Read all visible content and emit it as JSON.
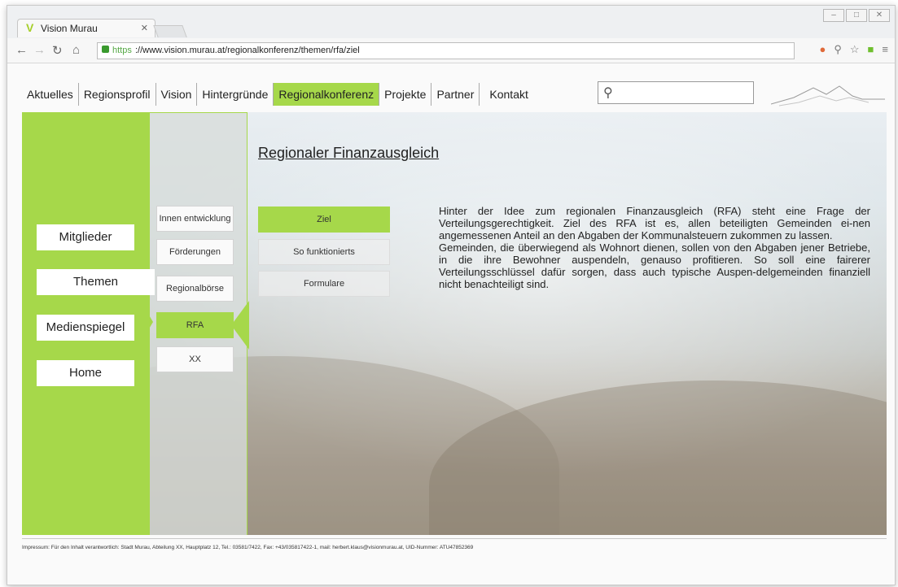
{
  "browser": {
    "tab_title": "Vision Murau",
    "tab_favicon": "V",
    "url_scheme": "https",
    "url_rest": "://www.vision.murau.at/regionalkonferenz/themen/rfa/ziel"
  },
  "nav": {
    "items": [
      "Aktuelles",
      "Regionsprofil",
      "Vision",
      "Hintergründe",
      "Regionalkonferenz",
      "Projekte",
      "Partner",
      "Kontakt"
    ],
    "active": "Regionalkonferenz"
  },
  "search": {
    "placeholder": ""
  },
  "sidebar": {
    "items": [
      "Mitglieder",
      "Themen",
      "Medienspiegel",
      "Home"
    ],
    "active": "Themen"
  },
  "submenu": {
    "items": [
      "Innen entwicklung",
      "Förderungen",
      "Regionalbörse",
      "RFA",
      "XX"
    ],
    "active": "RFA"
  },
  "tertiary": {
    "items": [
      "Ziel",
      "So funktionierts",
      "Formulare"
    ],
    "active": "Ziel"
  },
  "content": {
    "heading": "Regionaler Finanzausgleich",
    "para1": "Hinter der Idee zum regionalen Finanzausgleich (RFA) steht eine Frage der Verteilungsgerechtigkeit. Ziel des RFA ist es, allen beteiligten Gemeinden ei-nen angemessenen Anteil an den Abgaben der Kommunalsteuern zukommen zu lassen.",
    "para2": "Gemeinden, die überwiegend als Wohnort dienen, sollen von den Abgaben jener Betriebe, in die ihre Bewohner auspendeln, genauso profitieren. So soll eine fairerer Verteilungsschlüssel dafür sorgen, dass auch typische Auspen-delgemeinden finanziell nicht benachteiligt sind."
  },
  "footer": {
    "text": "Impressum: Für den Inhalt verantwortlich: Stadt Murau, Abteilung XX, Hauptplatz 12, Tel.: 03581/7422, Fax: +43/035817422-1, mail: herbert.klaus@visionmurau.at, UID-Nummer: ATU47852369"
  },
  "colors": {
    "accent": "#a6d84a"
  },
  "icons": [
    "back-icon",
    "forward-icon",
    "reload-icon",
    "home-icon",
    "lock-icon",
    "search-icon",
    "bookmark-star-icon",
    "extension-icon",
    "menu-icon"
  ]
}
